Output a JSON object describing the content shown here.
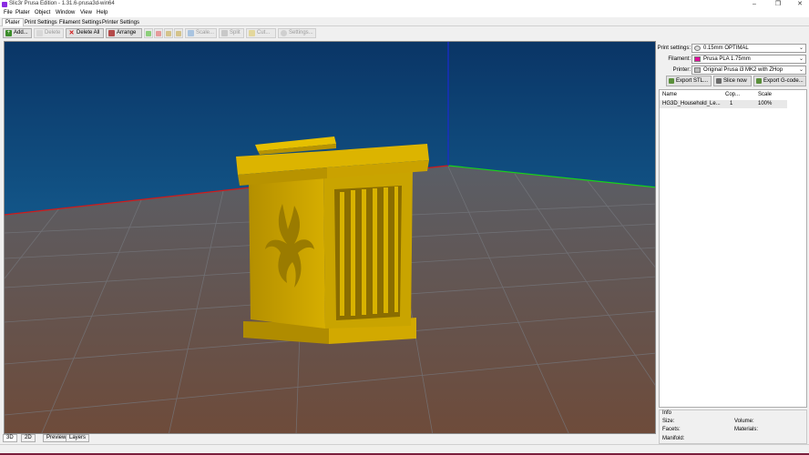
{
  "window": {
    "title": "Slic3r Prusa Edition - 1.31.6-prusa3d-win64",
    "controls": [
      "–",
      "❐",
      "✕"
    ]
  },
  "menu": [
    "File",
    "Plater",
    "Object",
    "Window",
    "View",
    "Help"
  ],
  "tabs": [
    {
      "label": "Plater",
      "active": true
    },
    {
      "label": "Print Settings",
      "active": false
    },
    {
      "label": "Filament Settings",
      "active": false
    },
    {
      "label": "Printer Settings",
      "active": false
    }
  ],
  "toolbar": {
    "add": "Add...",
    "delete": "Delete",
    "delete_all": "Delete All",
    "arrange": "Arrange",
    "scale": "Scale...",
    "split": "Split",
    "cut": "Cut...",
    "settings": "Settings..."
  },
  "right_panel": {
    "print_settings_label": "Print settings:",
    "print_settings_value": "0.15mm OPTIMAL",
    "filament_label": "Filament:",
    "filament_value": "Prusa PLA 1.75mm",
    "filament_color": "#e10d9a",
    "printer_label": "Printer:",
    "printer_value": "Original Prusa i3 MK2 with ZHop",
    "export_stl": "Export STL...",
    "slice_now": "Slice now",
    "export_gcode": "Export G-code...",
    "columns": {
      "name": "Name",
      "copies": "Cop...",
      "scale": "Scale"
    },
    "objects": [
      {
        "name": "HG3D_Household_Le...",
        "copies": "1",
        "scale": "100%"
      }
    ]
  },
  "info": {
    "title": "Info",
    "size": "Size:",
    "volume": "Volume:",
    "facets": "Facets:",
    "materials": "Materials:",
    "manifold": "Manifold:"
  },
  "view_tabs": [
    "3D",
    "2D",
    "Preview",
    "Layers"
  ],
  "colors": {
    "model": "#c9a400",
    "sky_top": "#0a3566",
    "sky_bottom": "#1d7fb3",
    "floor_top": "#5a5e66",
    "floor_bottom": "#6e4b3a",
    "x_axis": "#d21a1a",
    "y_axis": "#18d21a",
    "z_axis": "#1a2ad2",
    "status_accent": "#7a1f3d"
  }
}
